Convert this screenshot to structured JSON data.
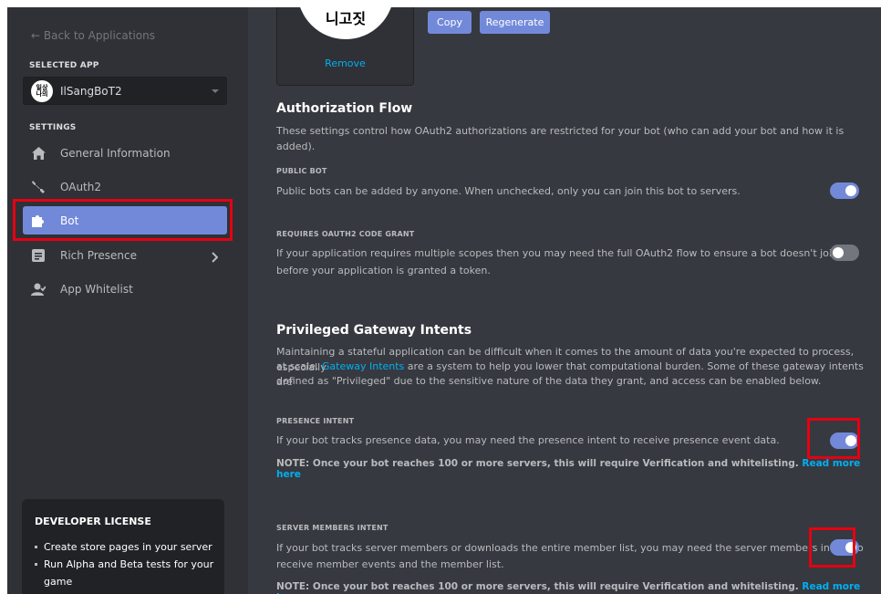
{
  "sidebar": {
    "back_link": "← Back to Applications",
    "selected_app_label": "SELECTED APP",
    "selected_app": {
      "name": "IlSangBoT2",
      "avatar_text": "일상\n나의"
    },
    "settings_label": "SETTINGS",
    "items": [
      {
        "label": "General Information",
        "icon": "home-icon",
        "active": false
      },
      {
        "label": "OAuth2",
        "icon": "wrench-icon",
        "active": false
      },
      {
        "label": "Bot",
        "icon": "puzzle-icon",
        "active": true
      },
      {
        "label": "Rich Presence",
        "icon": "document-icon",
        "active": false,
        "has_chevron": true
      },
      {
        "label": "App Whitelist",
        "icon": "user-check-icon",
        "active": false
      }
    ],
    "license": {
      "title": "DEVELOPER LICENSE",
      "items": [
        "Create store pages in your server",
        "Run Alpha and Beta tests for your game"
      ]
    }
  },
  "main": {
    "avatar": {
      "text": "니고짓",
      "remove_label": "Remove"
    },
    "token_buttons": {
      "copy": "Copy",
      "regenerate": "Regenerate"
    },
    "authorization": {
      "title": "Authorization Flow",
      "description": "These settings control how OAuth2 authorizations are restricted for your bot (who can add your bot and how it is added).",
      "public_bot": {
        "label": "PUBLIC BOT",
        "description": "Public bots can be added by anyone. When unchecked, only you can join this bot to servers.",
        "enabled": true
      },
      "code_grant": {
        "label": "REQUIRES OAUTH2 CODE GRANT",
        "description_line1": "If your application requires multiple scopes then you may need the full OAuth2 flow to ensure a bot doesn't join",
        "description_line2": "before your application is granted a token.",
        "enabled": false
      }
    },
    "intents": {
      "title": "Privileged Gateway Intents",
      "description_line1": "Maintaining a stateful application can be difficult when it comes to the amount of data you're expected to process, especially",
      "description_line2_pre": "at scale. ",
      "description_link": "Gateway Intents",
      "description_line2_post": " are a system to help you lower that computational burden. Some of these gateway intents are",
      "description_line3": "defined as \"Privileged\" due to the sensitive nature of the data they grant, and access can be enabled below.",
      "presence": {
        "label": "PRESENCE INTENT",
        "description": "If your bot tracks presence data, you may need the presence intent to receive presence event data.",
        "note": "NOTE: Once your bot reaches 100 or more servers, this will require Verification and whitelisting.",
        "read_more": "Read more here",
        "enabled": true
      },
      "server_members": {
        "label": "SERVER MEMBERS INTENT",
        "description_line1": "If your bot tracks server members or downloads the entire member list, you may need the server members intent to",
        "description_line2": "receive member events and the member list.",
        "note": "NOTE: Once your bot reaches 100 or more servers, this will require Verification and whitelisting.",
        "read_more": "Read more here",
        "enabled": true
      }
    }
  },
  "colors": {
    "accent": "#7289da",
    "link": "#00b0f4",
    "highlight": "#e60012",
    "background": "#36393f",
    "sidebar": "#2f3136"
  }
}
